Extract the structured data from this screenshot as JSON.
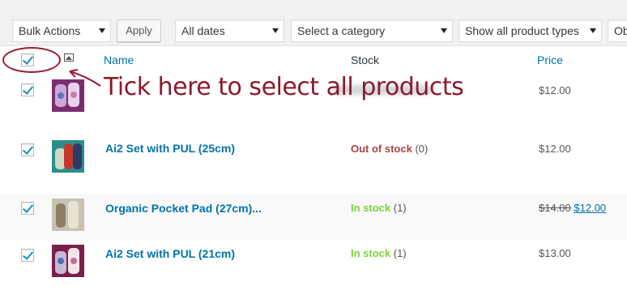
{
  "filters": {
    "bulk_actions": "Bulk Actions",
    "apply": "Apply",
    "dates": "All dates",
    "category": "Select a category",
    "product_types": "Show all product types",
    "stock_partial": "Ob"
  },
  "table": {
    "headers": {
      "name": "Name",
      "stock": "Stock",
      "price": "Price"
    },
    "rows": [
      {
        "name": "",
        "stock_status": "",
        "stock_qty": "",
        "price": "$12.00",
        "old_price": "",
        "checked": true
      },
      {
        "name": "Ai2 Set with PUL (25cm)",
        "stock_status": "Out of stock",
        "stock_qty": "(0)",
        "price": "$12.00",
        "old_price": "",
        "checked": true
      },
      {
        "name": "Organic Pocket Pad (27cm)...",
        "stock_status": "In stock",
        "stock_qty": "(1)",
        "price": "$12.00",
        "old_price": "$14.00",
        "checked": true
      },
      {
        "name": "Ai2 Set with PUL (21cm)",
        "stock_status": "In stock",
        "stock_qty": "(1)",
        "price": "$13.00",
        "old_price": "",
        "checked": true
      }
    ]
  },
  "annotation": {
    "text": "Tick here to select all products",
    "color": "#8b1a2b"
  },
  "colors": {
    "link": "#0073aa",
    "in_stock": "#7ad03a",
    "out_of_stock": "#aa4444"
  }
}
